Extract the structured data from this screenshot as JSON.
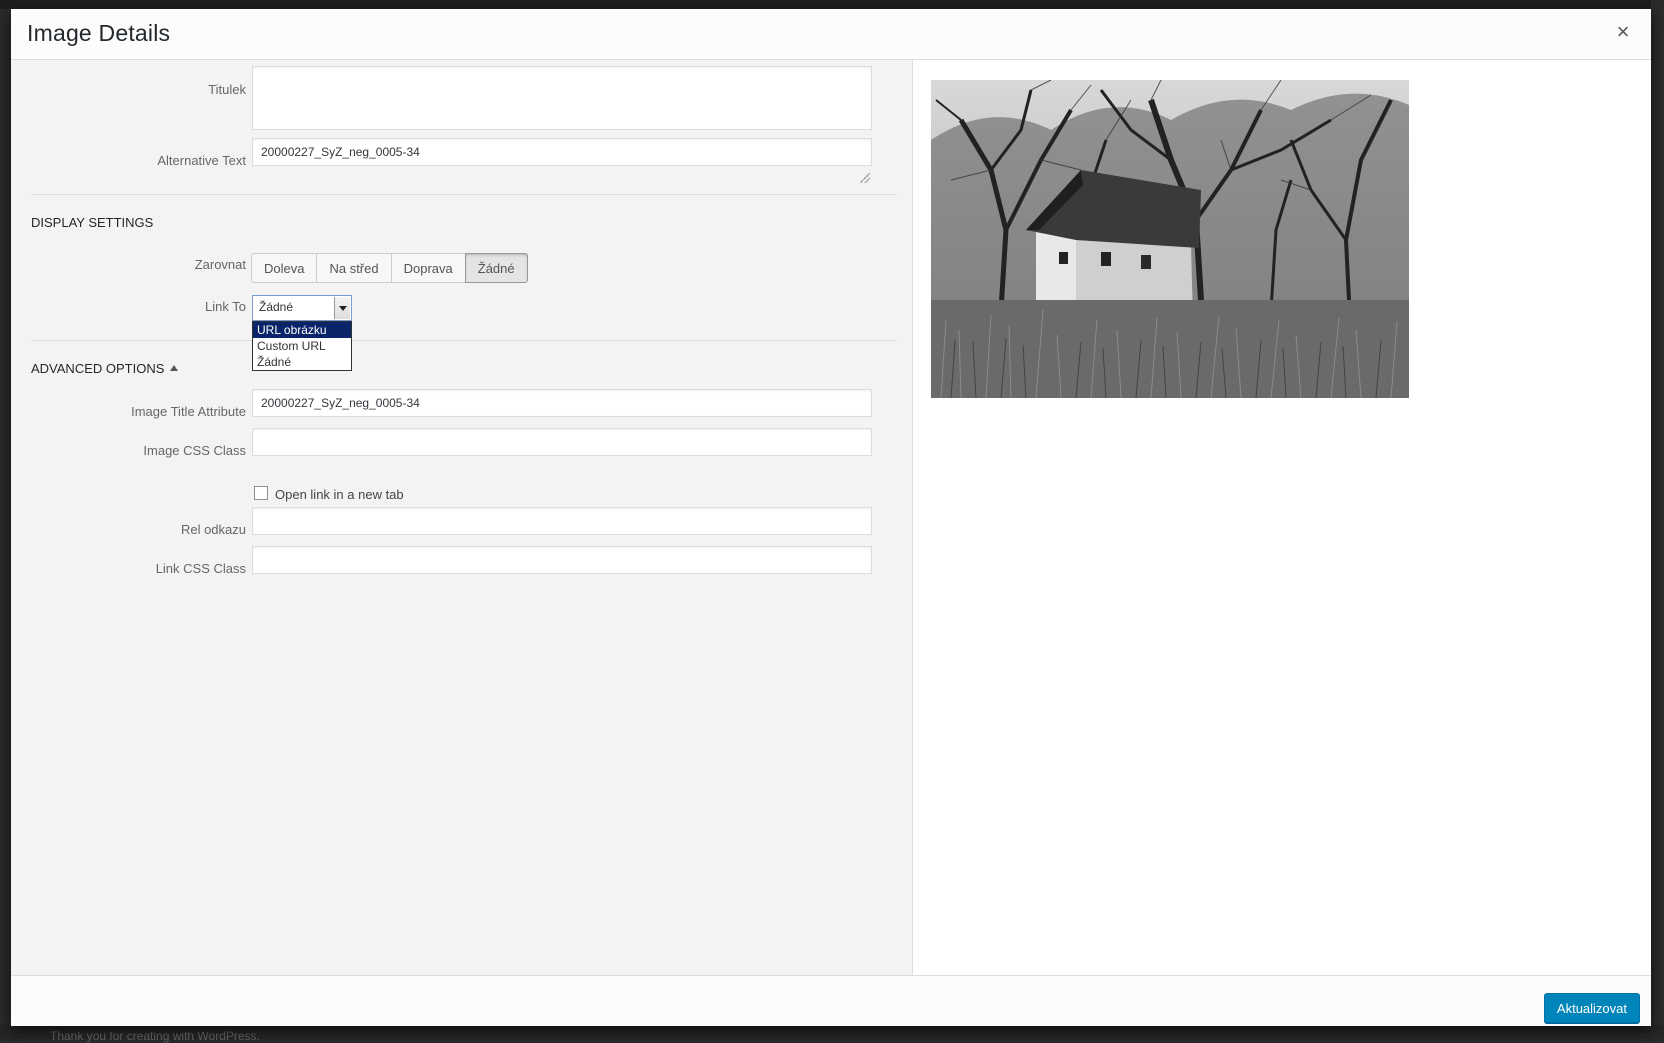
{
  "modal": {
    "title": "Image Details",
    "close_glyph": "×"
  },
  "fields": {
    "caption_label": "Titulek",
    "caption_value": "",
    "alt_label": "Alternative Text",
    "alt_value": "20000227_SyZ_neg_0005-34"
  },
  "display_settings": {
    "heading": "DISPLAY SETTINGS",
    "align_label": "Zarovnat",
    "align_options": [
      "Doleva",
      "Na střed",
      "Doprava",
      "Žádné"
    ],
    "align_selected": "Žádné",
    "link_to_label": "Link To",
    "link_to_value": "Žádné",
    "link_to_options": [
      "URL obrázku",
      "Custom URL",
      "Žádné"
    ],
    "link_to_highlighted": "URL obrázku"
  },
  "advanced_options": {
    "heading": "ADVANCED OPTIONS",
    "title_attr_label": "Image Title Attribute",
    "title_attr_value": "20000227_SyZ_neg_0005-34",
    "css_class_label": "Image CSS Class",
    "css_class_value": "",
    "new_tab_label": "Open link in a new tab",
    "new_tab_checked": false,
    "rel_label": "Rel odkazu",
    "rel_value": "",
    "link_css_label": "Link CSS Class",
    "link_css_value": ""
  },
  "footer": {
    "update_label": "Aktualizovat"
  },
  "background": {
    "footer_text": "Thank you for creating with WordPress."
  },
  "colors": {
    "primary_button": "#0085ba",
    "panel_bg": "#f3f3f3",
    "dropdown_highlight": "#0a246a"
  },
  "icons": {
    "close": "close-icon",
    "select_arrow": "chevron-down-icon",
    "advanced_toggle": "caret-up-icon"
  }
}
